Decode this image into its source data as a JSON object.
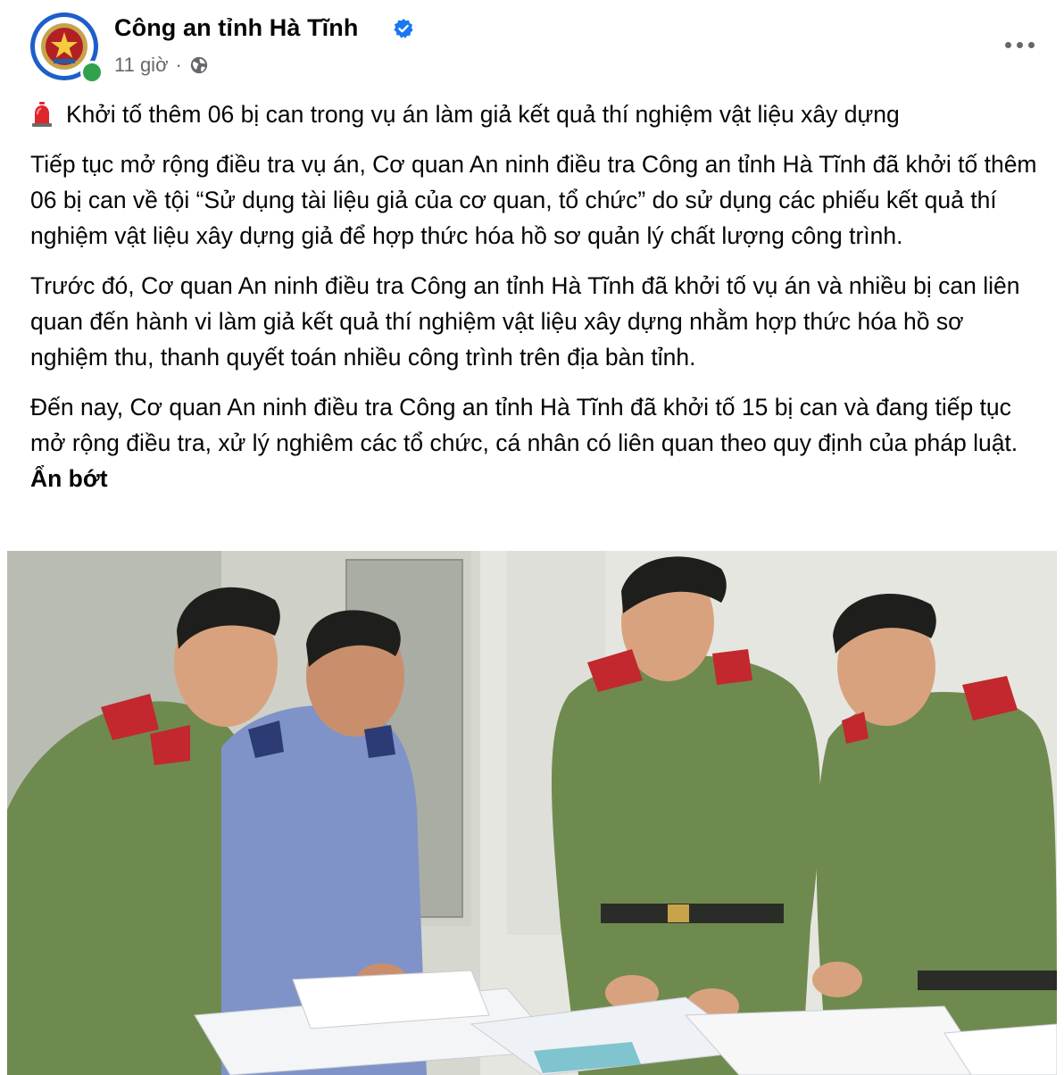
{
  "post": {
    "page_name": "Công an tỉnh Hà Tĩnh",
    "time": "11 giờ",
    "separator": "·",
    "privacy_icon": "globe-icon",
    "verified_icon": "verified-badge-icon",
    "more_icon": "more-options-icon",
    "headline_emoji": "siren-icon",
    "headline": "Khởi tố thêm 06 bị can trong vụ án làm giả kết quả thí nghiệm vật liệu xây dựng",
    "paragraph_1": "Tiếp tục mở rộng điều tra vụ án, Cơ quan An ninh điều tra Công an tỉnh Hà Tĩnh đã khởi tố thêm 06 bị can về tội “Sử dụng tài liệu giả của cơ quan, tổ chức” do sử dụng các phiếu kết quả thí nghiệm vật liệu xây dựng giả để hợp thức hóa hồ sơ quản lý chất lượng công trình.",
    "paragraph_2": "Trước đó, Cơ quan An ninh điều tra Công an tỉnh Hà Tĩnh đã khởi tố vụ án và nhiều bị can liên quan đến hành vi làm giả kết quả thí nghiệm vật liệu xây dựng nhằm hợp thức hóa hồ sơ nghiệm thu, thanh quyết toán nhiều công trình trên địa bàn tỉnh.",
    "paragraph_3": "Đến nay, Cơ quan An ninh điều tra Công an tỉnh Hà Tĩnh đã khởi tố 15 bị can và đang tiếp tục mở rộng điều tra, xử lý nghiêm các tổ chức, cá nhân có liên quan theo quy định của pháp luật.",
    "see_less": "Ẩn bớt"
  },
  "colors": {
    "text": "#050505",
    "secondary_text": "#65676b",
    "verified_blue": "#1877f2",
    "online_green": "#31a24c",
    "uniform_green": "#6f8a4f",
    "uniform_blue": "#7f93c8",
    "epaulette_red": "#c2282d"
  }
}
